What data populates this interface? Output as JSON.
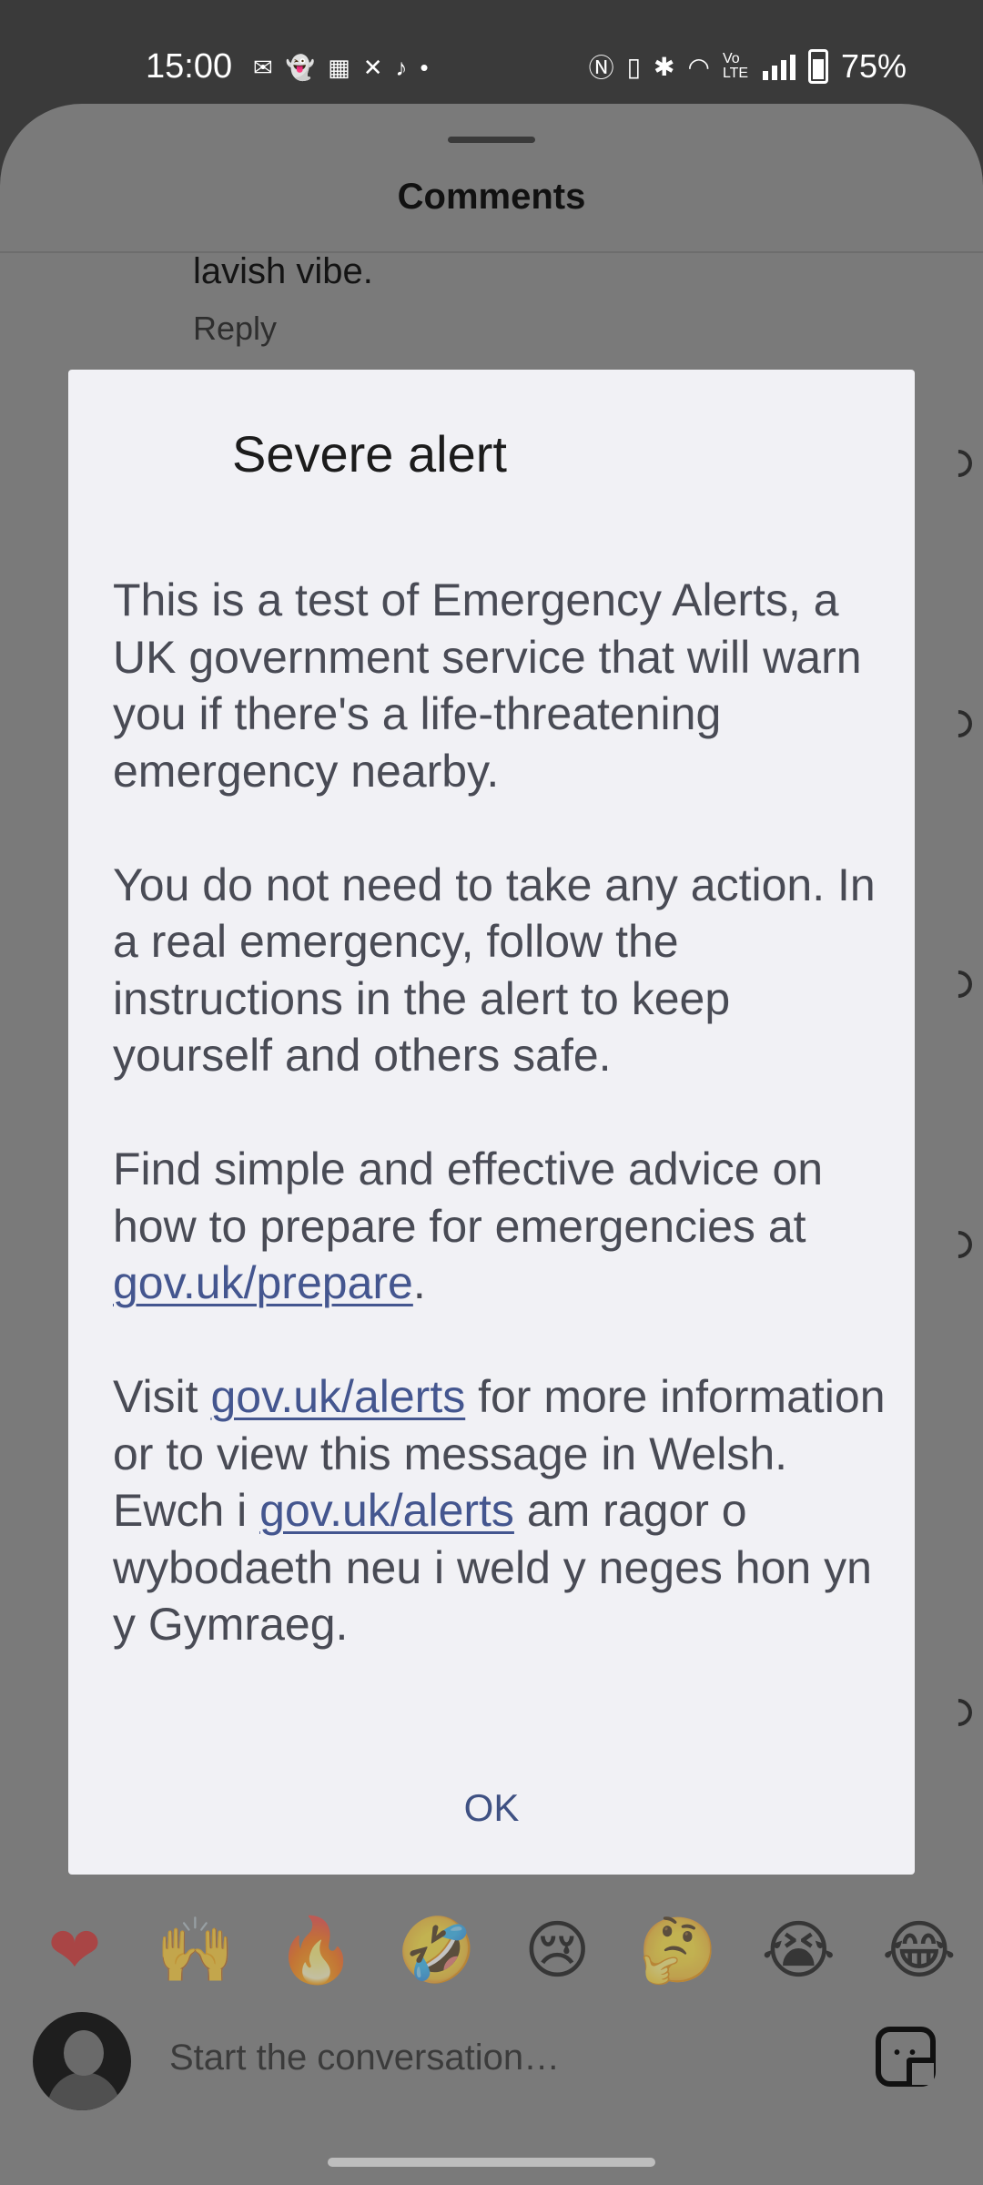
{
  "status_bar": {
    "time": "15:00",
    "left_icons": [
      "messenger-icon",
      "snapchat-icon",
      "temu-icon",
      "halifax-icon",
      "tiktok-icon",
      "dot-icon"
    ],
    "right_icons": [
      "nfc-icon",
      "vibrate-icon",
      "bluetooth-icon",
      "wifi-icon",
      "volte-icon",
      "signal-icon",
      "battery-icon"
    ],
    "volte_label": "Vo LTE",
    "battery": "75%"
  },
  "sheet": {
    "title": "Comments",
    "comment_text": "lavish vibe.",
    "reply_label": "Reply"
  },
  "dialog": {
    "title": "Severe alert",
    "p1": "This is a test of Emergency Alerts, a UK government service that will warn you if there's a life-threatening emergency nearby.",
    "p2": "You do not need to take any action. In a real emergency, follow the instructions in the alert to keep yourself and others safe.",
    "p3_before": "Find simple and effective advice on how to prepare for emergencies at ",
    "p3_link": "gov.uk/prepare",
    "p3_after": ".",
    "p4_before": "Visit ",
    "p4_link": "gov.uk/alerts",
    "p4_after": " for more information or to view this message in Welsh.",
    "p5_before": "Ewch i ",
    "p5_link": "gov.uk/alerts",
    "p5_after": " am ragor o wybodaeth neu i weld y neges hon yn y Gymraeg.",
    "ok_label": "OK"
  },
  "reactions": [
    "❤",
    "🙌",
    "🔥",
    "🤣",
    "😢",
    "🤔",
    "😭",
    "😂"
  ],
  "composer": {
    "placeholder": "Start the conversation…"
  }
}
